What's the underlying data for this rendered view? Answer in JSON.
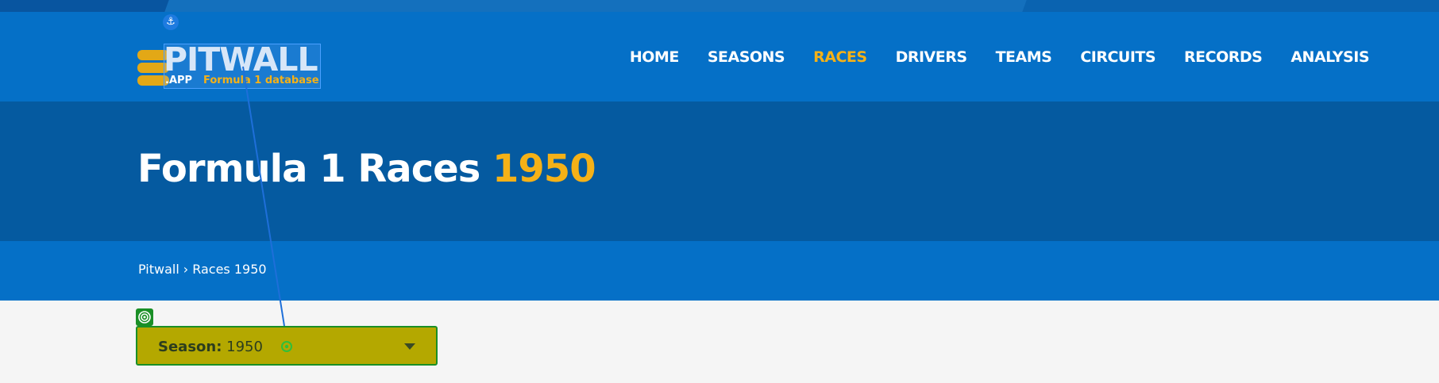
{
  "header": {
    "logo_main": "PITWALL",
    "logo_app": ".APP",
    "logo_sub": "Formula 1 database",
    "nav": [
      {
        "label": "HOME"
      },
      {
        "label": "SEASONS"
      },
      {
        "label": "RACES",
        "active": true
      },
      {
        "label": "DRIVERS"
      },
      {
        "label": "TEAMS"
      },
      {
        "label": "CIRCUITS"
      },
      {
        "label": "RECORDS"
      },
      {
        "label": "ANALYSIS"
      }
    ]
  },
  "hero": {
    "title": "Formula 1 Races",
    "year": "1950"
  },
  "breadcrumb": {
    "home": "Pitwall",
    "separator": "›",
    "current": "Races 1950"
  },
  "season_select": {
    "label": "Season:",
    "value": "1950"
  },
  "colors": {
    "header_bg": "#0570c7",
    "hero_bg": "#055aa0",
    "accent": "#f5b117",
    "select_bg": "#b4a800",
    "select_border": "#1a8f26"
  },
  "icons": {
    "anchor": "anchor-icon",
    "target": "target-icon",
    "caret": "chevron-down-icon",
    "logo_coins": "coin-stack-icon"
  }
}
